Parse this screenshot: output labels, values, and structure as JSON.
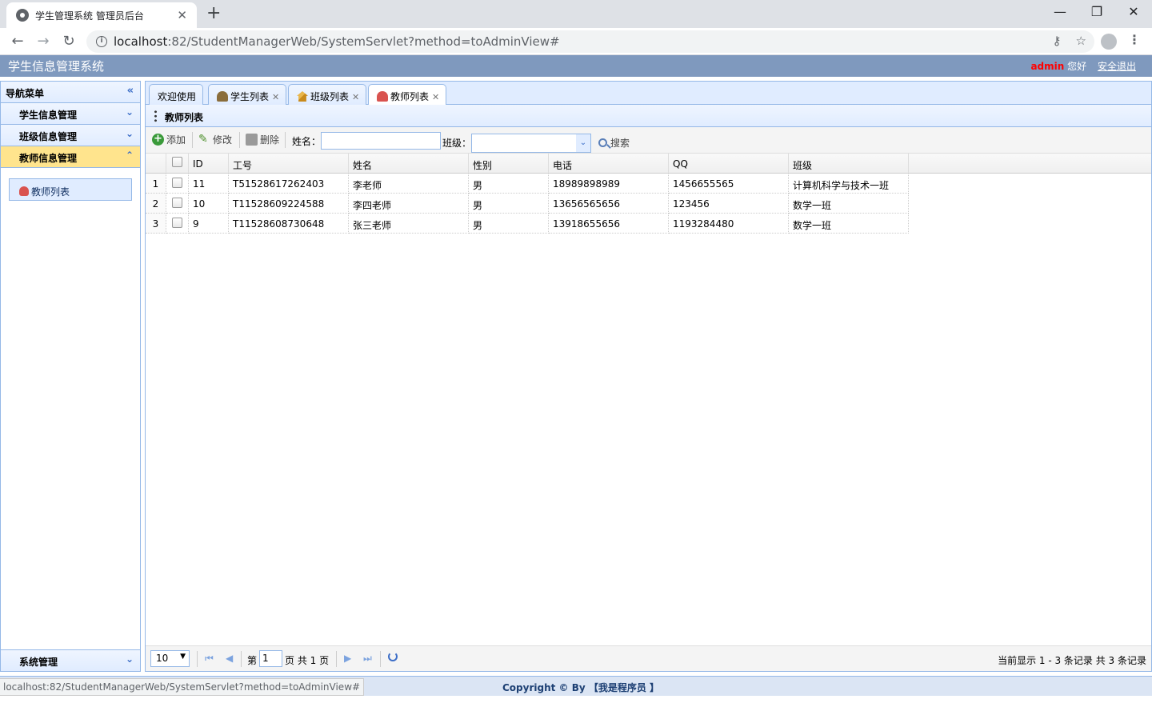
{
  "browser": {
    "tab_title": "学生管理系统 管理员后台",
    "url_host": "localhost",
    "url_rest": ":82/StudentManagerWeb/SystemServlet?method=toAdminView#",
    "status_url": "localhost:82/StudentManagerWeb/SystemServlet?method=toAdminView#"
  },
  "header": {
    "title": "学生信息管理系统",
    "username": "admin",
    "greeting": "您好",
    "logout": "安全退出"
  },
  "sidebar": {
    "title": "导航菜单",
    "items": [
      {
        "label": "学生信息管理"
      },
      {
        "label": "班级信息管理"
      },
      {
        "label": "教师信息管理"
      }
    ],
    "sub_link": "教师列表",
    "bottom_item": "系统管理"
  },
  "tabs": [
    {
      "label": "欢迎使用"
    },
    {
      "label": "学生列表"
    },
    {
      "label": "班级列表"
    },
    {
      "label": "教师列表"
    }
  ],
  "panel": {
    "title": "教师列表"
  },
  "toolbar": {
    "add": "添加",
    "edit": "修改",
    "delete": "删除",
    "name_label": "姓名：",
    "name_value": "",
    "class_label": "班级：",
    "search": "搜索"
  },
  "grid": {
    "columns": [
      "ID",
      "工号",
      "姓名",
      "性别",
      "电话",
      "QQ",
      "班级"
    ],
    "rows": [
      {
        "rn": "1",
        "id": "11",
        "sn": "T51528617262403",
        "name": "李老师",
        "sex": "男",
        "phone": "18989898989",
        "qq": "1456655565",
        "clazz": "计算机科学与技术一班"
      },
      {
        "rn": "2",
        "id": "10",
        "sn": "T11528609224588",
        "name": "李四老师",
        "sex": "男",
        "phone": "13656565656",
        "qq": "123456",
        "clazz": "数学一班"
      },
      {
        "rn": "3",
        "id": "9",
        "sn": "T11528608730648",
        "name": "张三老师",
        "sex": "男",
        "phone": "13918655656",
        "qq": "1193284480",
        "clazz": "数学一班"
      }
    ]
  },
  "pager": {
    "page_size": "10",
    "page_prefix": "第",
    "page_value": "1",
    "page_suffix": "页 共 1 页",
    "info": "当前显示 1 - 3 条记录 共 3 条记录"
  },
  "footer": {
    "copyright": "Copyright © By 【我是程序员 】"
  },
  "colors": {
    "accent": "#95b8e7",
    "header_bg": "#7f99be",
    "active_menu": "#ffe48d",
    "username": "#ff0000"
  }
}
